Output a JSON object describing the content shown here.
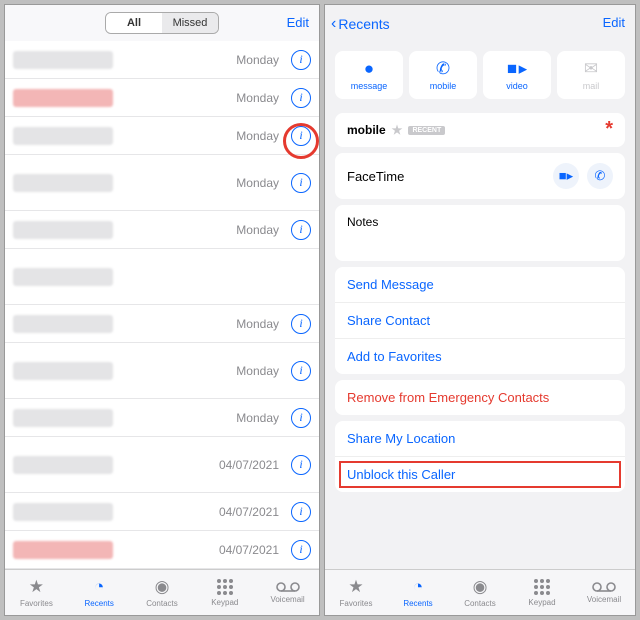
{
  "left": {
    "segAll": "All",
    "segMissed": "Missed",
    "edit": "Edit",
    "rows": [
      {
        "date": "Monday",
        "highlight": false,
        "red": false,
        "tall": false
      },
      {
        "date": "Monday",
        "highlight": false,
        "red": true,
        "tall": false
      },
      {
        "date": "Monday",
        "highlight": true,
        "red": false,
        "tall": false
      },
      {
        "date": "Monday",
        "highlight": false,
        "red": false,
        "tall": true
      },
      {
        "date": "Monday",
        "highlight": false,
        "red": false,
        "tall": false
      },
      {
        "date": "",
        "highlight": false,
        "red": false,
        "tall": true
      },
      {
        "date": "Monday",
        "highlight": false,
        "red": false,
        "tall": false
      },
      {
        "date": "Monday",
        "highlight": false,
        "red": false,
        "tall": true
      },
      {
        "date": "Monday",
        "highlight": false,
        "red": false,
        "tall": false
      },
      {
        "date": "04/07/2021",
        "highlight": false,
        "red": false,
        "tall": true
      },
      {
        "date": "04/07/2021",
        "highlight": false,
        "red": false,
        "tall": false
      },
      {
        "date": "04/07/2021",
        "highlight": false,
        "red": true,
        "tall": false
      }
    ]
  },
  "right": {
    "back": "Recents",
    "edit": "Edit",
    "actions": {
      "message": "message",
      "mobile": "mobile",
      "video": "video",
      "mail": "mail"
    },
    "mobileLabel": "mobile",
    "recentTag": "RECENT",
    "facetime": "FaceTime",
    "notes": "Notes",
    "menu1": [
      "Send Message",
      "Share Contact",
      "Add to Favorites"
    ],
    "removeEmergency": "Remove from Emergency Contacts",
    "shareLocation": "Share My Location",
    "unblock": "Unblock this Caller"
  },
  "tabs": {
    "favorites": "Favorites",
    "recents": "Recents",
    "contacts": "Contacts",
    "keypad": "Keypad",
    "voicemail": "Voicemail"
  }
}
